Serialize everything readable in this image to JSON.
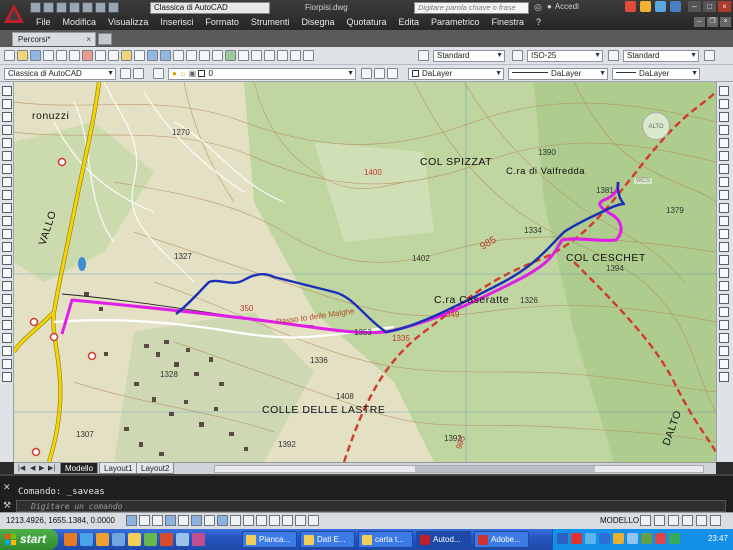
{
  "titlebar": {
    "workspace": "Classica di AutoCAD",
    "document_title": "Fiorpisi.dwg",
    "search_placeholder": "Digitare parola chiave o frase",
    "user": "Accedi"
  },
  "menu": [
    "File",
    "Modifica",
    "Visualizza",
    "Inserisci",
    "Formato",
    "Strumenti",
    "Disegna",
    "Quotatura",
    "Edita",
    "Parametrico",
    "Finestra",
    "?"
  ],
  "tabs": {
    "document_tab": "Percorsi*",
    "close": "×"
  },
  "toolbar2": {
    "workspace": "Classica di AutoCAD",
    "layer": "0",
    "color": "DaLayer",
    "linetype": "DaLayer",
    "lineweight": "DaLayer"
  },
  "styles_toolbar": {
    "text_style": "Standard",
    "dim_style": "ISO-25",
    "table_style": "Standard"
  },
  "map": {
    "places": [
      "COL SPIZZAT",
      "C.ra di Valfredda",
      "COL CESCHET",
      "C.ra Caseratte",
      "COLLE DELLE LASTRE",
      "ronuzzi",
      "VALLO",
      "DALTO"
    ],
    "road_label": "Passo to delle Malghe",
    "elevations": [
      "1270",
      "1327",
      "1400",
      "1390",
      "1381",
      "1379",
      "1334",
      "1402",
      "1394",
      "1326",
      "1353",
      "1335",
      "1336",
      "1408",
      "1392",
      "1307",
      "1328",
      "1392"
    ],
    "trail_numbers": [
      "985",
      "350",
      "349",
      "985"
    ],
    "viewcube": "ALTO",
    "wcs": "WCS"
  },
  "layout_tabs": {
    "model": "Modello",
    "layout1": "Layout1",
    "layout2": "Layout2"
  },
  "command": {
    "history": "Comando: _saveas",
    "prompt": "Digitare un comando"
  },
  "statusbar": {
    "coords": "1213.4926, 1655.1384, 0.0000",
    "space": "MODELLO"
  },
  "taskbar": {
    "start": "start",
    "tasks": [
      "Pianca...",
      "Dati E...",
      "carta t...",
      "Autod...",
      "Adobe..."
    ],
    "clock": "23:47"
  },
  "colors": {
    "route_blue": "#1a2fb8",
    "route_magenta": "#e01ee8",
    "trail_red": "#d23b2b",
    "road_yellow": "#f5d400"
  }
}
